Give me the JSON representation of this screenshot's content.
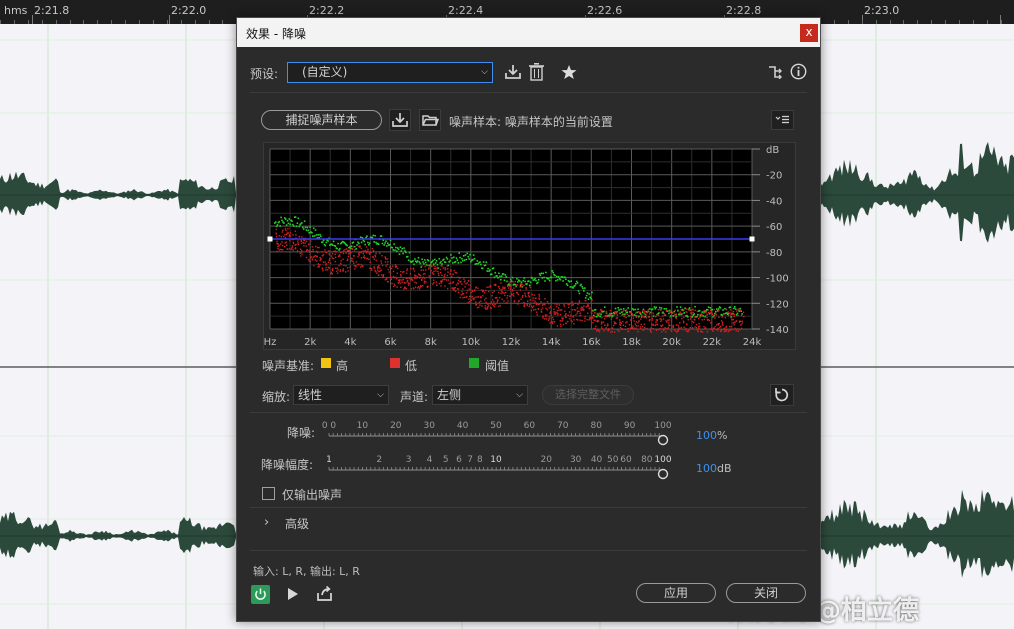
{
  "ruler": {
    "unit": "hms",
    "ticks": [
      "2:21.8",
      "2:22.0",
      "2:22.2",
      "2:22.4",
      "2:22.6",
      "2:22.8",
      "2:23.0"
    ]
  },
  "dialog": {
    "title": "效果 - 降噪",
    "close_label": "x",
    "preset_label": "预设:",
    "preset_value": "(自定义)",
    "capture_button": "捕捉噪声样本",
    "sample_info": "噪声样本: 噪声样本的当前设置",
    "spectrum": {
      "db_labels": [
        "dB",
        "-20",
        "-40",
        "-60",
        "-80",
        "-100",
        "-120",
        "-140"
      ],
      "freq_labels": [
        "Hz",
        "2k",
        "4k",
        "6k",
        "8k",
        "10k",
        "12k",
        "14k",
        "16k",
        "18k",
        "20k",
        "22k",
        "24k"
      ]
    },
    "legend": {
      "title": "噪声基准:",
      "items": [
        {
          "label": "高",
          "color": "#f2c40f"
        },
        {
          "label": "低",
          "color": "#e03131"
        },
        {
          "label": "阈值",
          "color": "#1fa82a"
        }
      ]
    },
    "scale_label": "缩放:",
    "scale_value": "线性",
    "channel_label": "声道:",
    "channel_value": "左侧",
    "select_file_button": "选择完整文件",
    "noise_reduction": {
      "label": "降噪:",
      "ticks": [
        "0 0",
        "10",
        "20",
        "30",
        "40",
        "50",
        "60",
        "70",
        "80",
        "90",
        "100"
      ],
      "value": "100",
      "unit": "%"
    },
    "reduce_by": {
      "label": "降噪幅度:",
      "ticks": [
        "1",
        "2",
        "3",
        "4",
        "5",
        "6",
        "7",
        "8",
        "10",
        "20",
        "30",
        "40",
        "50",
        "60",
        "80",
        "100"
      ],
      "value": "100",
      "unit": "dB"
    },
    "output_noise_only": "仅输出噪声",
    "advanced": "高级",
    "io_text": "输入: L, R,  输出: L, R",
    "apply_button": "应用",
    "close_button": "关闭"
  },
  "watermark": "众师云 @柏立德",
  "colors": {
    "waveform": "#2c4a3c",
    "green_trace": "#22d32a",
    "red_trace": "#d42020",
    "threshold_line": "#3a3af0",
    "accent_blue": "#3f8ff0"
  }
}
